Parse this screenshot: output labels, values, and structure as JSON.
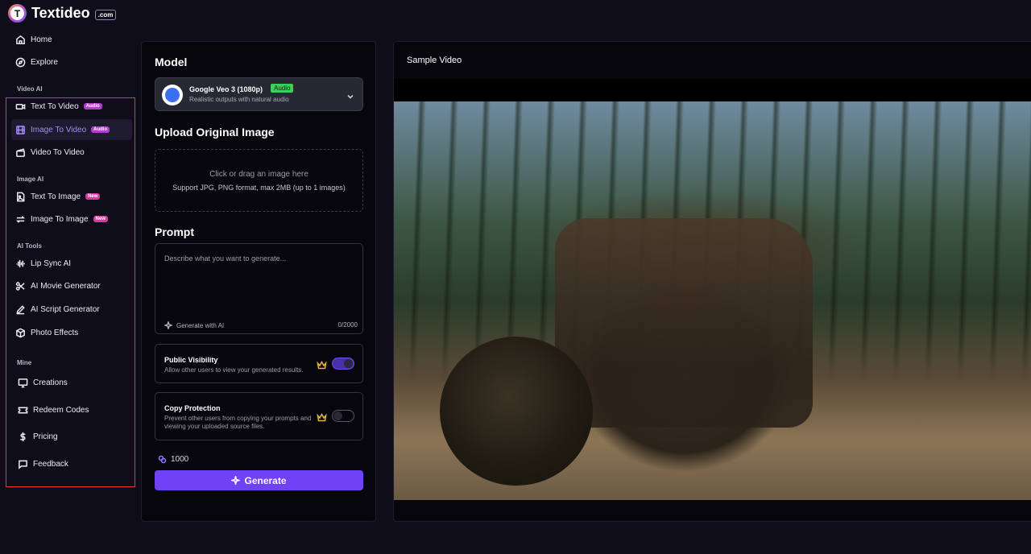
{
  "brand": {
    "name": "Textideo",
    "suffix": ".com",
    "mark": "T"
  },
  "sidebar": {
    "home": "Home",
    "explore": "Explore",
    "sections": {
      "video_ai": "Video AI",
      "image_ai": "Image AI",
      "ai_tools": "AI Tools",
      "mine": "Mine"
    },
    "video_items": [
      {
        "label": "Text To Video",
        "badge": "Audio"
      },
      {
        "label": "Image To Video",
        "badge": "Audio"
      },
      {
        "label": "Video To Video"
      }
    ],
    "image_items": [
      {
        "label": "Text To Image",
        "badge": "New"
      },
      {
        "label": "Image To Image",
        "badge": "New"
      }
    ],
    "tool_items": [
      {
        "label": "Lip Sync AI"
      },
      {
        "label": "AI Movie Generator"
      },
      {
        "label": "AI Script Generator"
      },
      {
        "label": "Photo Effects"
      }
    ],
    "mine_items": [
      {
        "label": "Creations"
      },
      {
        "label": "Redeem Codes"
      },
      {
        "label": "Pricing"
      },
      {
        "label": "Feedback"
      }
    ],
    "active_item": "Image To Video",
    "accent": "#a78bfa"
  },
  "form": {
    "model_heading": "Model",
    "model": {
      "name": "Google Veo 3 (1080p)",
      "badge": "Audio",
      "description": "Realistic outputs with natural audio"
    },
    "upload_heading": "Upload Original Image",
    "upload_main": "Click or drag an image here",
    "upload_sub": "Support JPG, PNG format, max 2MB (up to 1 images)",
    "prompt_heading": "Prompt",
    "prompt_placeholder": "Describe what you want to generate...",
    "generate_with_ai": "Generate with AI",
    "counter": "0/2000",
    "public_visibility": {
      "title": "Public Visibility",
      "desc": "Allow other users to view your generated results.",
      "enabled": true
    },
    "copy_protection": {
      "title": "Copy Protection",
      "desc": "Prevent other users from copying your prompts and viewing your uploaded source files.",
      "enabled": false
    },
    "credits": "1000",
    "generate_label": "Generate",
    "generate_color": "#7042f5"
  },
  "preview": {
    "title": "Sample Video"
  }
}
